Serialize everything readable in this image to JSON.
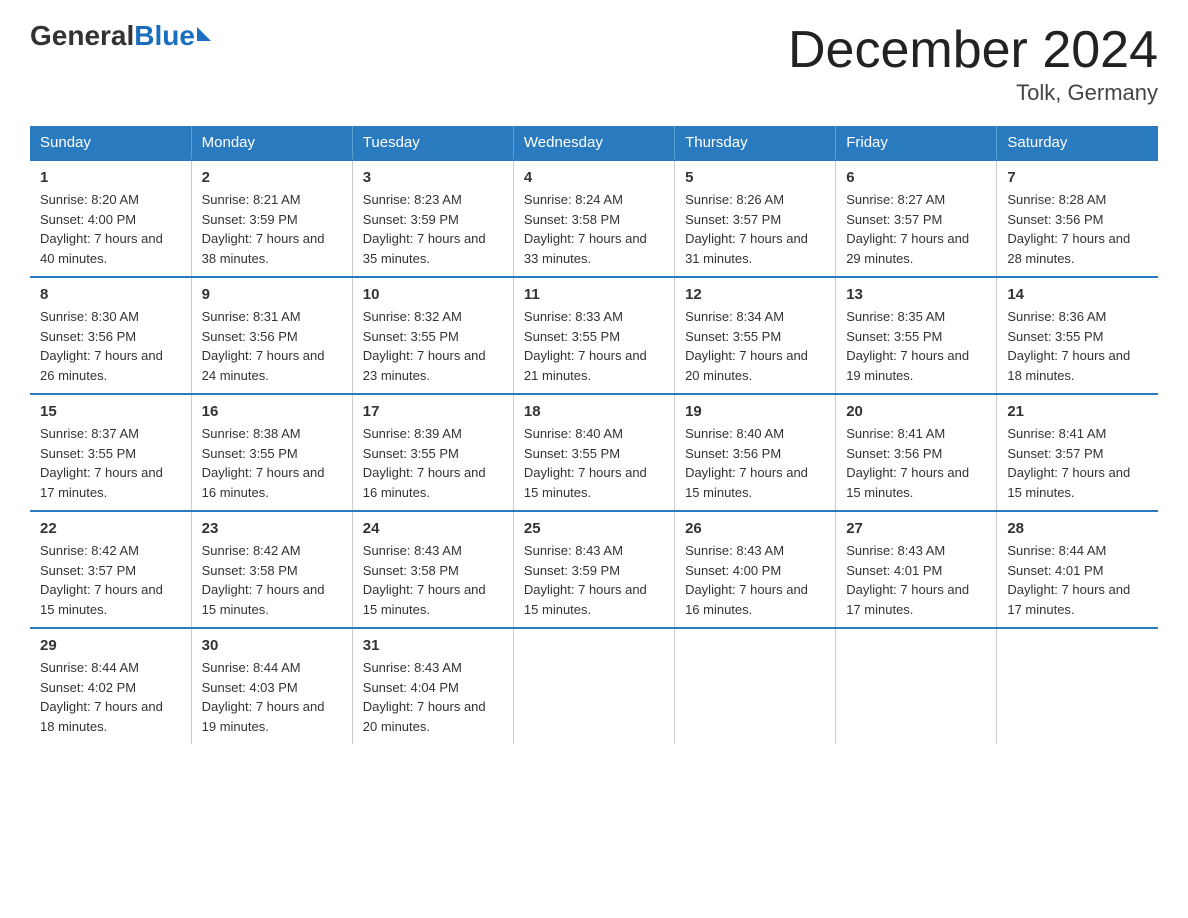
{
  "header": {
    "logo": {
      "general": "General",
      "blue": "Blue"
    },
    "title": "December 2024",
    "location": "Tolk, Germany"
  },
  "weekdays": [
    "Sunday",
    "Monday",
    "Tuesday",
    "Wednesday",
    "Thursday",
    "Friday",
    "Saturday"
  ],
  "weeks": [
    [
      {
        "day": "1",
        "sunrise": "8:20 AM",
        "sunset": "4:00 PM",
        "daylight": "7 hours and 40 minutes."
      },
      {
        "day": "2",
        "sunrise": "8:21 AM",
        "sunset": "3:59 PM",
        "daylight": "7 hours and 38 minutes."
      },
      {
        "day": "3",
        "sunrise": "8:23 AM",
        "sunset": "3:59 PM",
        "daylight": "7 hours and 35 minutes."
      },
      {
        "day": "4",
        "sunrise": "8:24 AM",
        "sunset": "3:58 PM",
        "daylight": "7 hours and 33 minutes."
      },
      {
        "day": "5",
        "sunrise": "8:26 AM",
        "sunset": "3:57 PM",
        "daylight": "7 hours and 31 minutes."
      },
      {
        "day": "6",
        "sunrise": "8:27 AM",
        "sunset": "3:57 PM",
        "daylight": "7 hours and 29 minutes."
      },
      {
        "day": "7",
        "sunrise": "8:28 AM",
        "sunset": "3:56 PM",
        "daylight": "7 hours and 28 minutes."
      }
    ],
    [
      {
        "day": "8",
        "sunrise": "8:30 AM",
        "sunset": "3:56 PM",
        "daylight": "7 hours and 26 minutes."
      },
      {
        "day": "9",
        "sunrise": "8:31 AM",
        "sunset": "3:56 PM",
        "daylight": "7 hours and 24 minutes."
      },
      {
        "day": "10",
        "sunrise": "8:32 AM",
        "sunset": "3:55 PM",
        "daylight": "7 hours and 23 minutes."
      },
      {
        "day": "11",
        "sunrise": "8:33 AM",
        "sunset": "3:55 PM",
        "daylight": "7 hours and 21 minutes."
      },
      {
        "day": "12",
        "sunrise": "8:34 AM",
        "sunset": "3:55 PM",
        "daylight": "7 hours and 20 minutes."
      },
      {
        "day": "13",
        "sunrise": "8:35 AM",
        "sunset": "3:55 PM",
        "daylight": "7 hours and 19 minutes."
      },
      {
        "day": "14",
        "sunrise": "8:36 AM",
        "sunset": "3:55 PM",
        "daylight": "7 hours and 18 minutes."
      }
    ],
    [
      {
        "day": "15",
        "sunrise": "8:37 AM",
        "sunset": "3:55 PM",
        "daylight": "7 hours and 17 minutes."
      },
      {
        "day": "16",
        "sunrise": "8:38 AM",
        "sunset": "3:55 PM",
        "daylight": "7 hours and 16 minutes."
      },
      {
        "day": "17",
        "sunrise": "8:39 AM",
        "sunset": "3:55 PM",
        "daylight": "7 hours and 16 minutes."
      },
      {
        "day": "18",
        "sunrise": "8:40 AM",
        "sunset": "3:55 PM",
        "daylight": "7 hours and 15 minutes."
      },
      {
        "day": "19",
        "sunrise": "8:40 AM",
        "sunset": "3:56 PM",
        "daylight": "7 hours and 15 minutes."
      },
      {
        "day": "20",
        "sunrise": "8:41 AM",
        "sunset": "3:56 PM",
        "daylight": "7 hours and 15 minutes."
      },
      {
        "day": "21",
        "sunrise": "8:41 AM",
        "sunset": "3:57 PM",
        "daylight": "7 hours and 15 minutes."
      }
    ],
    [
      {
        "day": "22",
        "sunrise": "8:42 AM",
        "sunset": "3:57 PM",
        "daylight": "7 hours and 15 minutes."
      },
      {
        "day": "23",
        "sunrise": "8:42 AM",
        "sunset": "3:58 PM",
        "daylight": "7 hours and 15 minutes."
      },
      {
        "day": "24",
        "sunrise": "8:43 AM",
        "sunset": "3:58 PM",
        "daylight": "7 hours and 15 minutes."
      },
      {
        "day": "25",
        "sunrise": "8:43 AM",
        "sunset": "3:59 PM",
        "daylight": "7 hours and 15 minutes."
      },
      {
        "day": "26",
        "sunrise": "8:43 AM",
        "sunset": "4:00 PM",
        "daylight": "7 hours and 16 minutes."
      },
      {
        "day": "27",
        "sunrise": "8:43 AM",
        "sunset": "4:01 PM",
        "daylight": "7 hours and 17 minutes."
      },
      {
        "day": "28",
        "sunrise": "8:44 AM",
        "sunset": "4:01 PM",
        "daylight": "7 hours and 17 minutes."
      }
    ],
    [
      {
        "day": "29",
        "sunrise": "8:44 AM",
        "sunset": "4:02 PM",
        "daylight": "7 hours and 18 minutes."
      },
      {
        "day": "30",
        "sunrise": "8:44 AM",
        "sunset": "4:03 PM",
        "daylight": "7 hours and 19 minutes."
      },
      {
        "day": "31",
        "sunrise": "8:43 AM",
        "sunset": "4:04 PM",
        "daylight": "7 hours and 20 minutes."
      },
      null,
      null,
      null,
      null
    ]
  ]
}
